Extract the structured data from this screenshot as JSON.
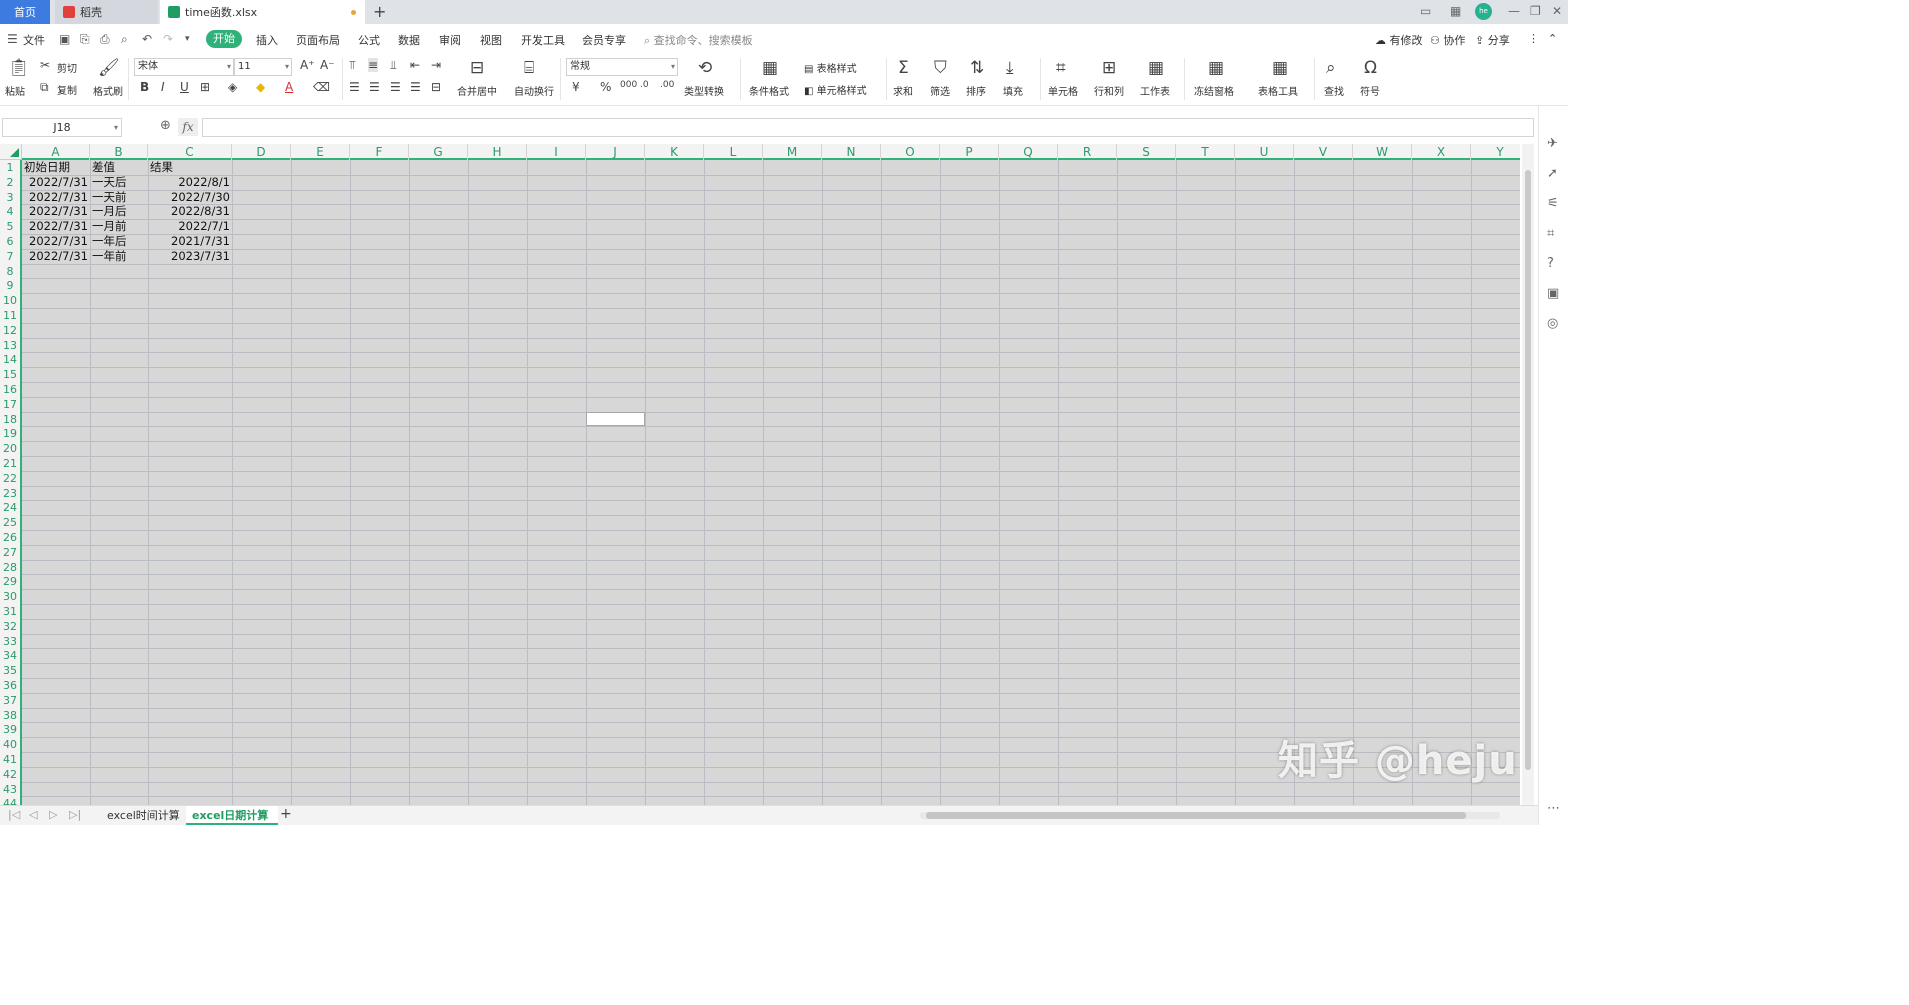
{
  "titlebar": {
    "home_tab": "首页",
    "app_tab": "稻壳",
    "file_tab": "time函数.xlsx",
    "avatar_text": "he"
  },
  "menubar": {
    "file_menu": "文件",
    "start_tab": "开始",
    "items": [
      "插入",
      "页面布局",
      "公式",
      "数据",
      "审阅",
      "视图",
      "开发工具",
      "会员专享"
    ],
    "search_placeholder": "查找命令、搜索模板",
    "right_items": [
      "有修改",
      "协作",
      "分享"
    ]
  },
  "ribbon": {
    "paste": "粘贴",
    "cut": "剪切",
    "copy": "复制",
    "format_painter": "格式刷",
    "font_name": "宋体",
    "font_size": "11",
    "merge_center": "合并居中",
    "wrap_text": "自动换行",
    "number_format": "常规",
    "type_convert": "类型转换",
    "conditional_format": "条件格式",
    "table_style": "表格样式",
    "cell_style": "单元格样式",
    "sum": "求和",
    "filter": "筛选",
    "sort": "排序",
    "fill": "填充",
    "cell": "单元格",
    "row_col": "行和列",
    "worksheet": "工作表",
    "freeze": "冻结窗格",
    "table_tools": "表格工具",
    "find": "查找",
    "symbol": "符号"
  },
  "formula_bar": {
    "name_box": "J18",
    "fx": "fx",
    "value": ""
  },
  "sheet": {
    "columns": [
      "A",
      "B",
      "C",
      "D",
      "E",
      "F",
      "G",
      "H",
      "I",
      "J",
      "K",
      "L",
      "M",
      "N",
      "O",
      "P",
      "Q",
      "R",
      "S",
      "T",
      "U",
      "V",
      "W",
      "X",
      "Y"
    ],
    "row_count": 44,
    "header_row": [
      "初始日期",
      "差值",
      "结果"
    ],
    "rows": [
      [
        "2022/7/31",
        "一天后",
        "2022/8/1"
      ],
      [
        "2022/7/31",
        "一天前",
        "2022/7/30"
      ],
      [
        "2022/7/31",
        "一月后",
        "2022/8/31"
      ],
      [
        "2022/7/31",
        "一月前",
        "2022/7/1"
      ],
      [
        "2022/7/31",
        "一年后",
        "2021/7/31"
      ],
      [
        "2022/7/31",
        "一年前",
        "2023/7/31"
      ]
    ],
    "active_cell": "J18"
  },
  "sheet_tabs": {
    "tabs": [
      "excel时间计算",
      "excel日期计算"
    ],
    "active_index": 1
  },
  "watermark": "知乎 @heju",
  "colors": {
    "accent": "#2fb27a",
    "home_tab": "#3d7be0",
    "grid_bg": "#d7d7d7",
    "header_text": "#2a9b6a"
  }
}
